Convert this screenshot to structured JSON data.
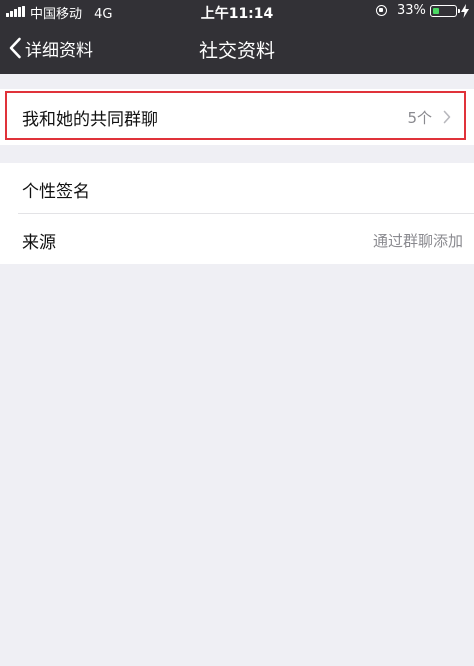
{
  "status_bar": {
    "carrier": "中国移动",
    "network": "4G",
    "time": "上午11:14",
    "battery_percent": "33%",
    "battery_level": 0.33,
    "battery_color": "#4cd964"
  },
  "nav": {
    "back_label": "详细资料",
    "title": "社交资料"
  },
  "rows": {
    "common_groups": {
      "label": "我和她的共同群聊",
      "value": "5个"
    },
    "signature": {
      "label": "个性签名"
    },
    "source": {
      "label": "来源",
      "value": "通过群聊添加"
    }
  },
  "colors": {
    "navbar_bg": "#323136",
    "page_bg": "#efeff4",
    "highlight": "#e0323a"
  },
  "icons": {
    "back": "chevron-left-icon",
    "disclosure": "chevron-right-icon",
    "signal": "signal-bars-icon",
    "battery": "battery-icon",
    "orientation_lock": "orientation-lock-icon",
    "charging": "charging-bolt-icon"
  }
}
